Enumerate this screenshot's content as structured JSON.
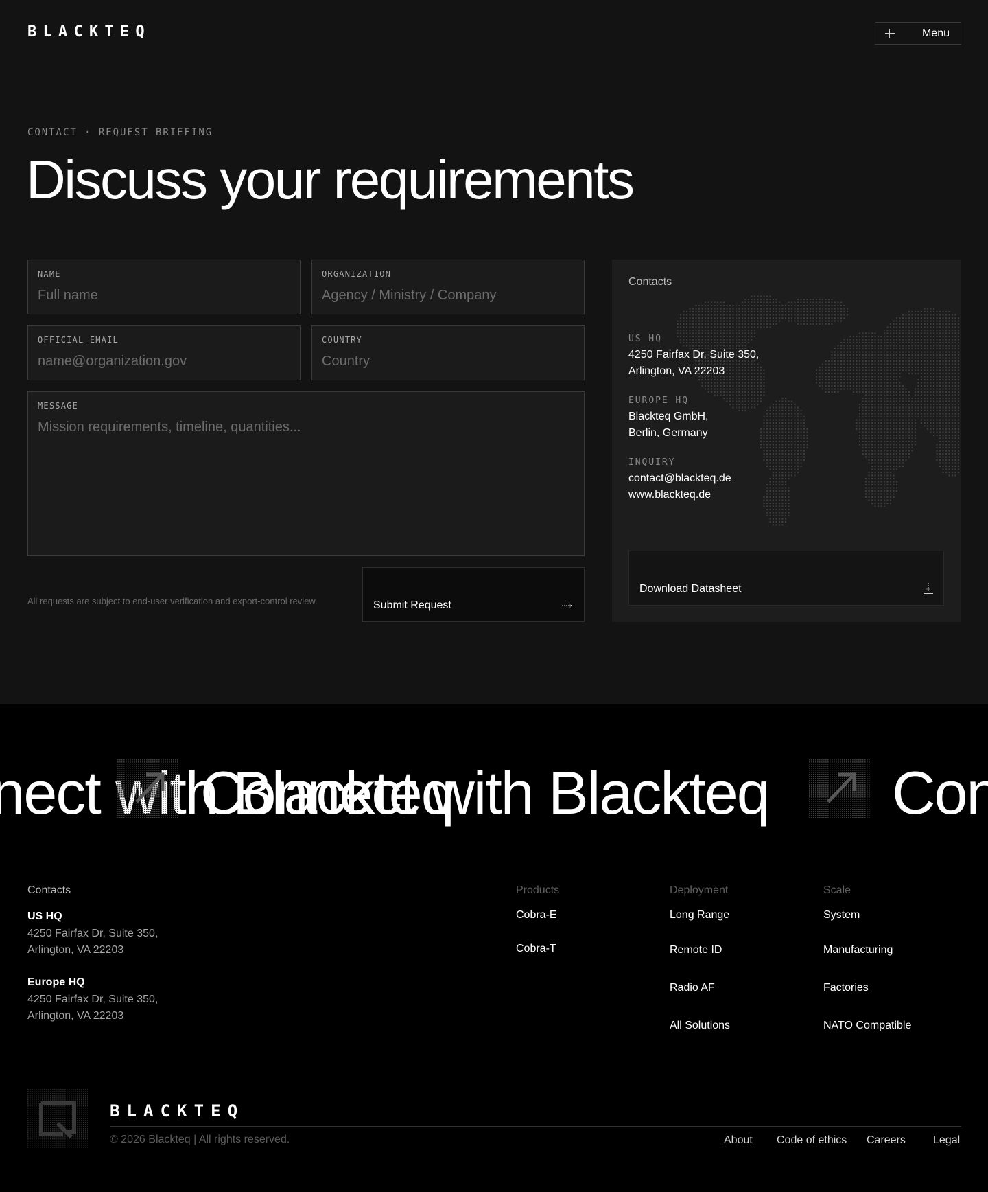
{
  "brand": {
    "logo": "BLACKTEQ"
  },
  "header": {
    "menu_label": "Menu"
  },
  "hero": {
    "eyebrow": "CONTACT · REQUEST BRIEFING",
    "title": "Discuss your requirements"
  },
  "form": {
    "name": {
      "label": "NAME",
      "placeholder": "Full name"
    },
    "organization": {
      "label": "ORGANIZATION",
      "placeholder": "Agency / Ministry / Company"
    },
    "email": {
      "label": "OFFICIAL EMAIL",
      "placeholder": "name@organization.gov"
    },
    "country": {
      "label": "COUNTRY",
      "placeholder": "Country"
    },
    "message": {
      "label": "MESSAGE",
      "placeholder": "Mission requirements, timeline, quantities..."
    },
    "disclaimer": "All requests are subject to end-user verification and export-control review.",
    "submit_label": "Submit Request"
  },
  "contacts_panel": {
    "title": "Contacts",
    "us": {
      "label": "US HQ",
      "line1": "4250 Fairfax Dr, Suite 350,",
      "line2": "Arlington, VA 22203"
    },
    "europe": {
      "label": "EUROPE HQ",
      "line1": "Blackteq GmbH,",
      "line2": "Berlin, Germany"
    },
    "inquiry": {
      "label": "INQUIRY",
      "email": "contact@blackteq.de",
      "web": "www.blackteq.de"
    },
    "download_label": "Download Datasheet"
  },
  "marquee": {
    "text": "Connect with Blackteq"
  },
  "footer": {
    "contacts_title": "Contacts",
    "us": {
      "title": "US HQ",
      "line1": "4250 Fairfax Dr, Suite 350,",
      "line2": "Arlington, VA 22203"
    },
    "europe": {
      "title": "Europe HQ",
      "line1": "4250 Fairfax Dr, Suite 350,",
      "line2": "Arlington, VA 22203"
    },
    "columns": [
      {
        "heading": "Products",
        "links": [
          "Cobra-E",
          "Cobra-T"
        ]
      },
      {
        "heading": "Deployment",
        "links": [
          "Long Range",
          "Remote ID",
          "Radio AF",
          "All Solutions"
        ]
      },
      {
        "heading": "Scale",
        "links": [
          "System",
          "Manufacturing",
          "Factories",
          "NATO Compatible"
        ]
      }
    ],
    "copyright": "© 2026 Blackteq | All rights reserved.",
    "bottom_links": [
      "About",
      "Code of ethics",
      "Careers",
      "Legal"
    ]
  },
  "colors": {
    "background": "#000000",
    "panel": "#131313",
    "field": "#1b1b1b",
    "text": "#ffffff",
    "muted": "#6a6a6a"
  },
  "icons": [
    "plus-icon",
    "arrow-right-icon",
    "download-icon",
    "world-map-dots",
    "arrow-tile-icon",
    "logo-tile-icon"
  ]
}
